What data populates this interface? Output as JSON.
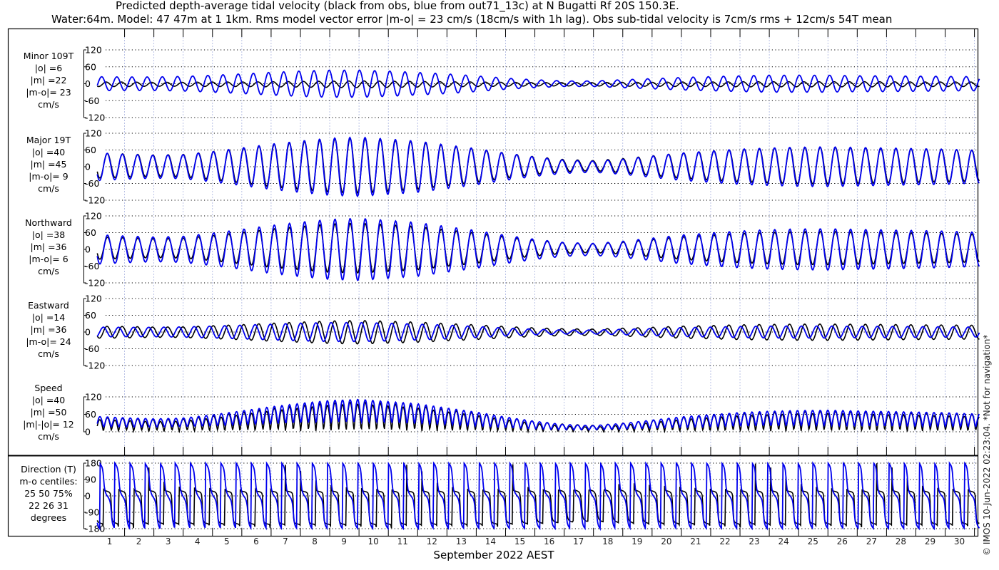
{
  "title_line1": "Predicted depth-average tidal velocity (black from obs, blue from out71_13c) at N Bugatti Rf 20S 150.3E.",
  "title_line2": "Water:64m. Model: 47 47m at 1 1km. Rms model vector error |m-o| = 23 cm/s (18cm/s with 1h lag). Obs sub-tidal velocity is 7cm/s rms + 12cm/s 54T mean",
  "xlabel": "September 2022 AEST",
  "copyright": "© IMOS 10-Jun-2022 02:23:04. *Not for navigation*",
  "colors": {
    "obs": "#000000",
    "model": "#0000ee",
    "grid": "#aab4e0"
  },
  "chart_data": {
    "type": "line",
    "x_unit": "day of September 2022",
    "xlim": [
      0.05,
      30.2
    ],
    "xticks": [
      "1",
      "2",
      "3",
      "4",
      "5",
      "6",
      "7",
      "8",
      "9",
      "10",
      "11",
      "12",
      "13",
      "14",
      "15",
      "16",
      "17",
      "18",
      "19",
      "20",
      "21",
      "22",
      "23",
      "24",
      "25",
      "26",
      "27",
      "28",
      "29",
      "30"
    ],
    "tidal_period_hours": 12.42,
    "major_axis_deg": 19,
    "envelope_note": "daily tidal amplitudes (cm/s) at start of each day 0..30",
    "major_amp_obs": [
      45,
      42,
      38,
      40,
      50,
      62,
      75,
      85,
      95,
      98,
      92,
      85,
      72,
      60,
      45,
      32,
      22,
      18,
      25,
      35,
      45,
      52,
      58,
      62,
      65,
      66,
      64,
      62,
      60,
      58,
      55
    ],
    "major_amp_model": [
      50,
      45,
      41,
      43,
      54,
      67,
      81,
      92,
      102,
      106,
      99,
      92,
      78,
      65,
      49,
      35,
      24,
      20,
      27,
      38,
      49,
      56,
      63,
      67,
      70,
      71,
      69,
      67,
      65,
      63,
      59
    ],
    "minor_amp_obs": [
      8,
      8,
      7,
      7,
      8,
      8,
      9,
      10,
      11,
      12,
      11,
      10,
      9,
      8,
      7,
      6,
      6,
      6,
      7,
      7,
      8,
      8,
      9,
      9,
      9,
      9,
      9,
      9,
      8,
      8,
      8
    ],
    "minor_amp_model": [
      25,
      24,
      24,
      26,
      30,
      35,
      40,
      45,
      48,
      48,
      45,
      40,
      35,
      28,
      20,
      14,
      10,
      10,
      14,
      18,
      22,
      25,
      28,
      30,
      30,
      30,
      28,
      28,
      27,
      26,
      25
    ],
    "panels": [
      {
        "key": "minor",
        "label": [
          "Minor 109T",
          "|o| =6",
          "|m| =22",
          "|m-o|= 23",
          "cm/s"
        ],
        "ylim": [
          -120,
          120
        ],
        "yticks": [
          "120",
          "60",
          "0",
          "-60",
          "-120"
        ],
        "ytick_values": [
          120,
          60,
          0,
          -60,
          -120
        ]
      },
      {
        "key": "major",
        "label": [
          "Major 19T",
          "|o| =40",
          "|m| =45",
          "|m-o|= 9",
          "cm/s"
        ],
        "ylim": [
          -120,
          120
        ],
        "yticks": [
          "120",
          "60",
          "0",
          "-60",
          "-120"
        ],
        "ytick_values": [
          120,
          60,
          0,
          -60,
          -120
        ]
      },
      {
        "key": "north",
        "label": [
          "Northward",
          "|o| =38",
          "|m| =36",
          "|m-o|= 6",
          "cm/s"
        ],
        "ylim": [
          -120,
          120
        ],
        "yticks": [
          "120",
          "60",
          "0",
          "-60",
          "-120"
        ],
        "ytick_values": [
          120,
          60,
          0,
          -60,
          -120
        ]
      },
      {
        "key": "east",
        "label": [
          "Eastward",
          "|o| =14",
          "|m| =36",
          "|m-o|= 24",
          "cm/s"
        ],
        "ylim": [
          -120,
          120
        ],
        "yticks": [
          "120",
          "60",
          "0",
          "-60",
          "-120"
        ],
        "ytick_values": [
          120,
          60,
          0,
          -60,
          -120
        ]
      },
      {
        "key": "speed",
        "label": [
          "Speed",
          "|o| =40",
          "|m| =50",
          "|m|-|o|= 12",
          "cm/s"
        ],
        "ylim": [
          0,
          120
        ],
        "yticks": [
          "120",
          "60",
          "0"
        ],
        "ytick_values": [
          120,
          60,
          0
        ]
      },
      {
        "key": "dir",
        "label": [
          "Direction (T)",
          "m-o centiles:",
          "25  50  75%",
          "22  26  31",
          "degrees"
        ],
        "ylim": [
          -180,
          180
        ],
        "yticks": [
          "180",
          "90",
          "0",
          "-90",
          "-180"
        ],
        "ytick_values": [
          180,
          90,
          0,
          -90,
          -180
        ]
      }
    ]
  }
}
